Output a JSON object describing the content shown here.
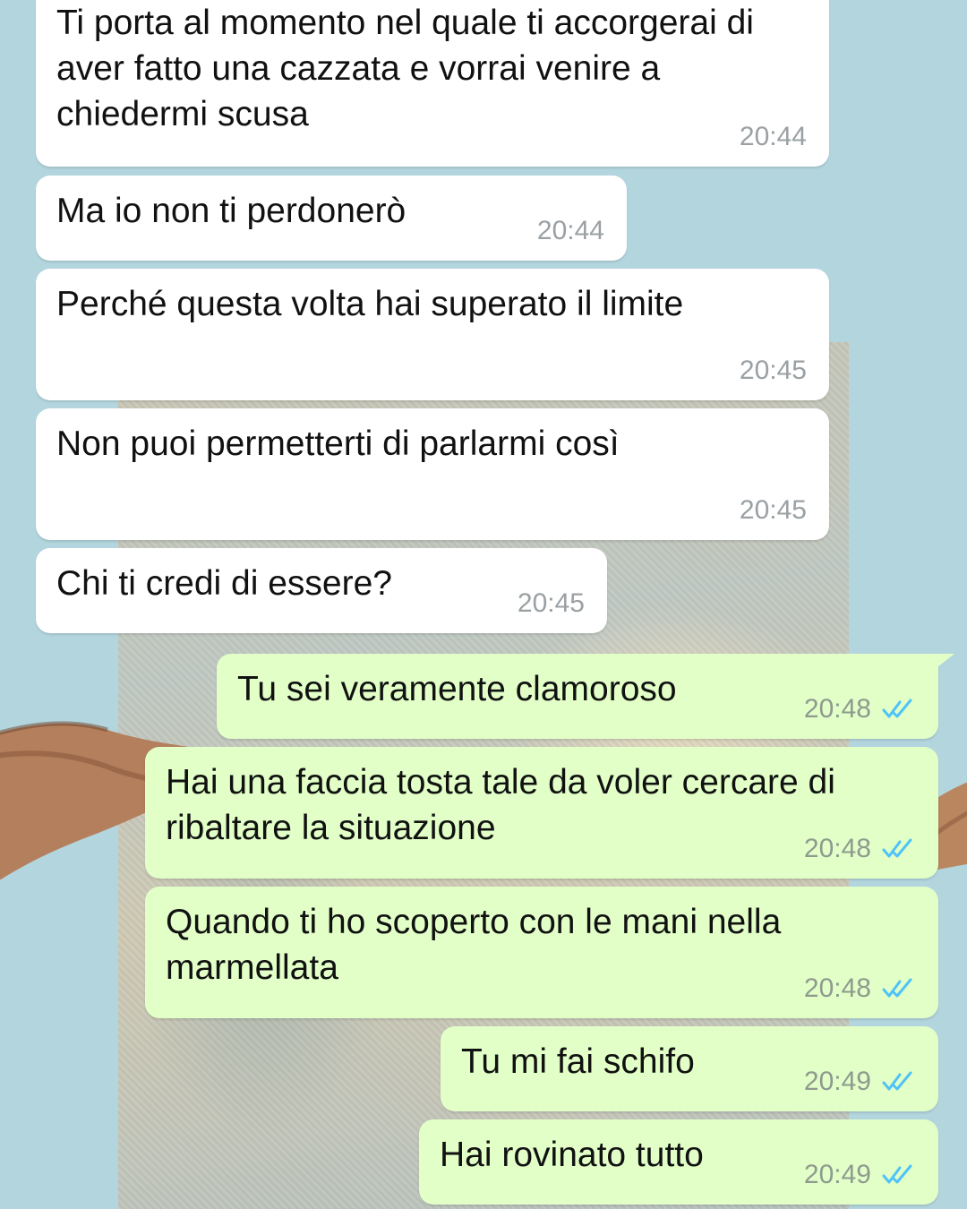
{
  "colors": {
    "wallpaper": "#b3d5de",
    "incoming_bubble": "#ffffff",
    "outgoing_bubble": "#e1ffc7",
    "read_receipt": "#4fc3f7"
  },
  "messages": [
    {
      "direction": "incoming",
      "text": "Ti porta al momento nel quale ti accorgerai di aver fatto una cazzata e vorrai venire a chiedermi scusa",
      "time": "20:44"
    },
    {
      "direction": "incoming",
      "text": "Ma io non ti perdonerò",
      "time": "20:44"
    },
    {
      "direction": "incoming",
      "text": "Perché questa volta hai superato il limite",
      "time": "20:45"
    },
    {
      "direction": "incoming",
      "text": "Non puoi permetterti di parlarmi così",
      "time": "20:45"
    },
    {
      "direction": "incoming",
      "text": "Chi ti credi di essere?",
      "time": "20:45"
    },
    {
      "direction": "outgoing",
      "text": "Tu sei veramente clamoroso",
      "time": "20:48",
      "status_icon": "double-check-read-icon"
    },
    {
      "direction": "outgoing",
      "text": "Hai una faccia tosta tale da voler cercare di ribaltare la situazione",
      "time": "20:48",
      "status_icon": "double-check-read-icon"
    },
    {
      "direction": "outgoing",
      "text": "Quando ti ho scoperto con le mani nella marmellata",
      "time": "20:48",
      "status_icon": "double-check-read-icon"
    },
    {
      "direction": "outgoing",
      "text": "Tu mi fai schifo",
      "time": "20:49",
      "status_icon": "double-check-read-icon"
    },
    {
      "direction": "outgoing",
      "text": "Hai rovinato tutto",
      "time": "20:49",
      "status_icon": "double-check-read-icon"
    }
  ]
}
